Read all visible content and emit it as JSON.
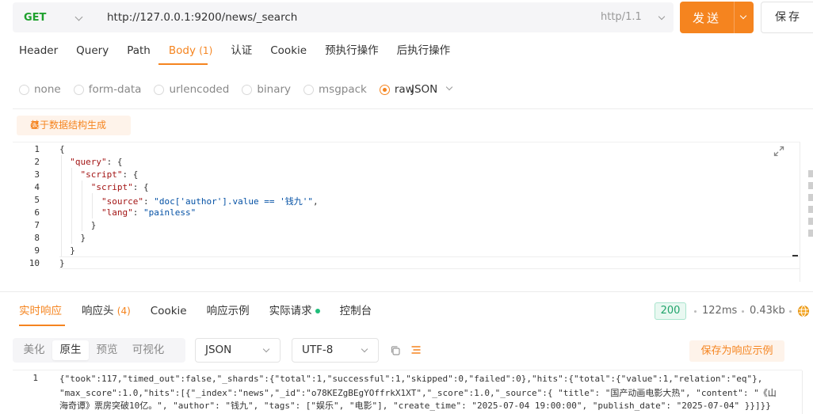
{
  "request": {
    "method": "GET",
    "url": "http://127.0.0.1:9200/news/_search",
    "protocol": "http/1.1",
    "send_label": "发送",
    "save_label": "保存"
  },
  "request_tabs": [
    {
      "label": "Header"
    },
    {
      "label": "Query"
    },
    {
      "label": "Path"
    },
    {
      "label": "Body",
      "count": "(1)",
      "active": true
    },
    {
      "label": "认证"
    },
    {
      "label": "Cookie"
    },
    {
      "label": "预执行操作"
    },
    {
      "label": "后执行操作"
    }
  ],
  "body_types": [
    {
      "label": "none"
    },
    {
      "label": "form-data"
    },
    {
      "label": "urlencoded"
    },
    {
      "label": "binary"
    },
    {
      "label": "msgpack"
    },
    {
      "label": "raw",
      "selected": true
    }
  ],
  "body_format": "JSON",
  "generate_button": "基于数据结构生成",
  "editor": {
    "line_numbers": [
      "1",
      "2",
      "3",
      "4",
      "5",
      "6",
      "7",
      "8",
      "9",
      "10"
    ],
    "lines": [
      "{",
      "  \"query\": {",
      "    \"script\": {",
      "      \"script\": {",
      "        \"source\": \"doc['author'].value == '钱九'\",",
      "        \"lang\": \"painless\"",
      "      }",
      "    }",
      "  }",
      "}"
    ]
  },
  "response_tabs": [
    {
      "label": "实时响应",
      "active": true
    },
    {
      "label": "响应头",
      "count": "(4)"
    },
    {
      "label": "Cookie"
    },
    {
      "label": "响应示例"
    },
    {
      "label": "实际请求",
      "live": true
    },
    {
      "label": "控制台"
    }
  ],
  "response_meta": {
    "status": "200",
    "time": "122ms",
    "size": "0.43kb"
  },
  "view_modes": [
    {
      "label": "美化"
    },
    {
      "label": "原生",
      "active": true
    },
    {
      "label": "预览"
    },
    {
      "label": "可视化"
    }
  ],
  "response_format": "JSON",
  "response_encoding": "UTF-8",
  "save_example_label": "保存为响应示例",
  "response": {
    "line_number": "1",
    "text_lines": [
      "{\"took\":117,\"timed_out\":false,\"_shards\":{\"total\":1,\"successful\":1,\"skipped\":0,\"failed\":0},\"hits\":{\"total\":{\"value\":1,\"relation\":\"eq\"},",
      "\"max_score\":1.0,\"hits\":[{\"_index\":\"news\",\"_id\":\"o78KEZgBEgYOffrkX1XT\",\"_score\":1.0,\"_source\":{ \"title\": \"国产动画电影大热\", \"content\": \"《山",
      "海奇谭》票房突破10亿。\", \"author\": \"钱九\", \"tags\": [\"娱乐\", \"电影\"], \"create_time\": \"2025-07-04 19:00:00\", \"publish_date\": \"2025-07-04\" }}]}}"
    ]
  },
  "colors": {
    "accent": "#f5841f",
    "method_get": "#1fa12e",
    "status_ok": "#1fa36a",
    "json_key": "#a31515",
    "json_string": "#0451a5"
  }
}
